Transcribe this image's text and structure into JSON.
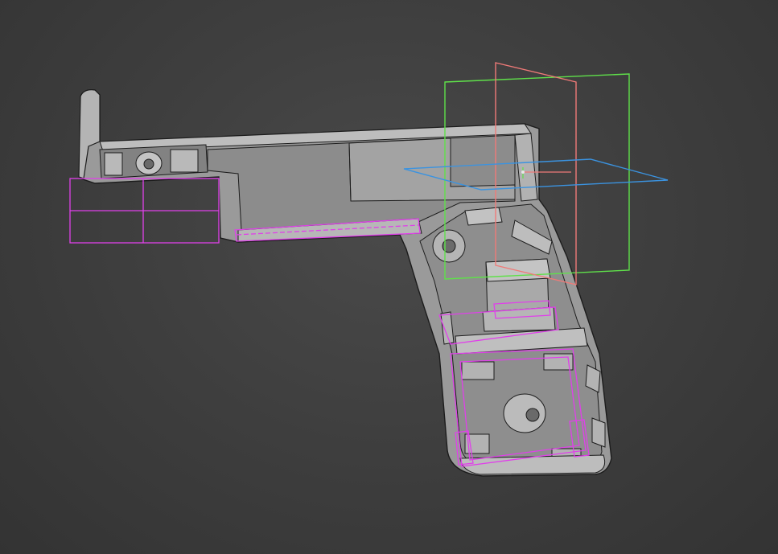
{
  "viewport": {
    "background_color": "#3f3f3f",
    "model": "pistol-frame-half-shell",
    "part_color": "#9c9c9c",
    "edge_color": "#1e1e1e",
    "sketch_color": "#e040ea",
    "planes": [
      {
        "name": "front-plane",
        "color": "#5fe04a"
      },
      {
        "name": "right-plane",
        "color": "#f07a78"
      },
      {
        "name": "top-plane",
        "color": "#3b93e0"
      }
    ]
  }
}
